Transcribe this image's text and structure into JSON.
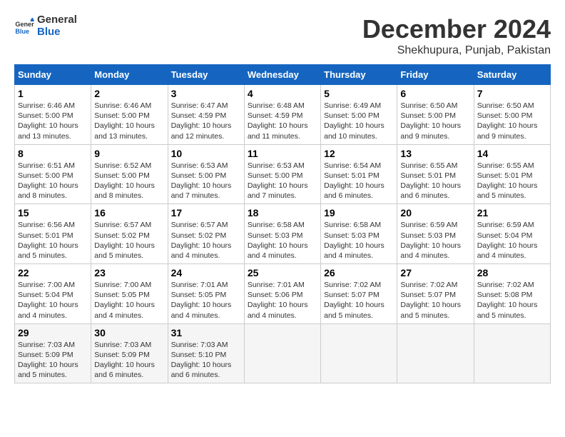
{
  "header": {
    "logo_line1": "General",
    "logo_line2": "Blue",
    "month": "December 2024",
    "location": "Shekhupura, Punjab, Pakistan"
  },
  "weekdays": [
    "Sunday",
    "Monday",
    "Tuesday",
    "Wednesday",
    "Thursday",
    "Friday",
    "Saturday"
  ],
  "weeks": [
    [
      {
        "day": "1",
        "detail": "Sunrise: 6:46 AM\nSunset: 5:00 PM\nDaylight: 10 hours\nand 13 minutes."
      },
      {
        "day": "2",
        "detail": "Sunrise: 6:46 AM\nSunset: 5:00 PM\nDaylight: 10 hours\nand 13 minutes."
      },
      {
        "day": "3",
        "detail": "Sunrise: 6:47 AM\nSunset: 4:59 PM\nDaylight: 10 hours\nand 12 minutes."
      },
      {
        "day": "4",
        "detail": "Sunrise: 6:48 AM\nSunset: 4:59 PM\nDaylight: 10 hours\nand 11 minutes."
      },
      {
        "day": "5",
        "detail": "Sunrise: 6:49 AM\nSunset: 5:00 PM\nDaylight: 10 hours\nand 10 minutes."
      },
      {
        "day": "6",
        "detail": "Sunrise: 6:50 AM\nSunset: 5:00 PM\nDaylight: 10 hours\nand 9 minutes."
      },
      {
        "day": "7",
        "detail": "Sunrise: 6:50 AM\nSunset: 5:00 PM\nDaylight: 10 hours\nand 9 minutes."
      }
    ],
    [
      {
        "day": "8",
        "detail": "Sunrise: 6:51 AM\nSunset: 5:00 PM\nDaylight: 10 hours\nand 8 minutes."
      },
      {
        "day": "9",
        "detail": "Sunrise: 6:52 AM\nSunset: 5:00 PM\nDaylight: 10 hours\nand 8 minutes."
      },
      {
        "day": "10",
        "detail": "Sunrise: 6:53 AM\nSunset: 5:00 PM\nDaylight: 10 hours\nand 7 minutes."
      },
      {
        "day": "11",
        "detail": "Sunrise: 6:53 AM\nSunset: 5:00 PM\nDaylight: 10 hours\nand 7 minutes."
      },
      {
        "day": "12",
        "detail": "Sunrise: 6:54 AM\nSunset: 5:01 PM\nDaylight: 10 hours\nand 6 minutes."
      },
      {
        "day": "13",
        "detail": "Sunrise: 6:55 AM\nSunset: 5:01 PM\nDaylight: 10 hours\nand 6 minutes."
      },
      {
        "day": "14",
        "detail": "Sunrise: 6:55 AM\nSunset: 5:01 PM\nDaylight: 10 hours\nand 5 minutes."
      }
    ],
    [
      {
        "day": "15",
        "detail": "Sunrise: 6:56 AM\nSunset: 5:01 PM\nDaylight: 10 hours\nand 5 minutes."
      },
      {
        "day": "16",
        "detail": "Sunrise: 6:57 AM\nSunset: 5:02 PM\nDaylight: 10 hours\nand 5 minutes."
      },
      {
        "day": "17",
        "detail": "Sunrise: 6:57 AM\nSunset: 5:02 PM\nDaylight: 10 hours\nand 4 minutes."
      },
      {
        "day": "18",
        "detail": "Sunrise: 6:58 AM\nSunset: 5:03 PM\nDaylight: 10 hours\nand 4 minutes."
      },
      {
        "day": "19",
        "detail": "Sunrise: 6:58 AM\nSunset: 5:03 PM\nDaylight: 10 hours\nand 4 minutes."
      },
      {
        "day": "20",
        "detail": "Sunrise: 6:59 AM\nSunset: 5:03 PM\nDaylight: 10 hours\nand 4 minutes."
      },
      {
        "day": "21",
        "detail": "Sunrise: 6:59 AM\nSunset: 5:04 PM\nDaylight: 10 hours\nand 4 minutes."
      }
    ],
    [
      {
        "day": "22",
        "detail": "Sunrise: 7:00 AM\nSunset: 5:04 PM\nDaylight: 10 hours\nand 4 minutes."
      },
      {
        "day": "23",
        "detail": "Sunrise: 7:00 AM\nSunset: 5:05 PM\nDaylight: 10 hours\nand 4 minutes."
      },
      {
        "day": "24",
        "detail": "Sunrise: 7:01 AM\nSunset: 5:05 PM\nDaylight: 10 hours\nand 4 minutes."
      },
      {
        "day": "25",
        "detail": "Sunrise: 7:01 AM\nSunset: 5:06 PM\nDaylight: 10 hours\nand 4 minutes."
      },
      {
        "day": "26",
        "detail": "Sunrise: 7:02 AM\nSunset: 5:07 PM\nDaylight: 10 hours\nand 5 minutes."
      },
      {
        "day": "27",
        "detail": "Sunrise: 7:02 AM\nSunset: 5:07 PM\nDaylight: 10 hours\nand 5 minutes."
      },
      {
        "day": "28",
        "detail": "Sunrise: 7:02 AM\nSunset: 5:08 PM\nDaylight: 10 hours\nand 5 minutes."
      }
    ],
    [
      {
        "day": "29",
        "detail": "Sunrise: 7:03 AM\nSunset: 5:09 PM\nDaylight: 10 hours\nand 5 minutes."
      },
      {
        "day": "30",
        "detail": "Sunrise: 7:03 AM\nSunset: 5:09 PM\nDaylight: 10 hours\nand 6 minutes."
      },
      {
        "day": "31",
        "detail": "Sunrise: 7:03 AM\nSunset: 5:10 PM\nDaylight: 10 hours\nand 6 minutes."
      },
      {
        "day": "",
        "detail": ""
      },
      {
        "day": "",
        "detail": ""
      },
      {
        "day": "",
        "detail": ""
      },
      {
        "day": "",
        "detail": ""
      }
    ]
  ]
}
